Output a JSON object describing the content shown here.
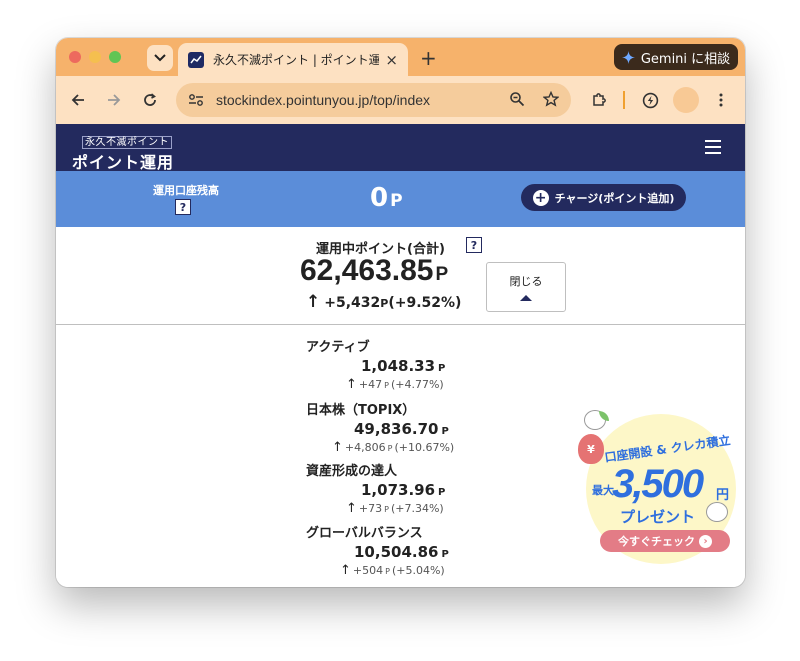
{
  "browser": {
    "tab_title": "永久不滅ポイント | ポイント運用",
    "url": "stockindex.pointunyou.jp/top/index",
    "gemini_label": "Gemini に相談",
    "new_tab": "+",
    "tab_close": "×"
  },
  "site": {
    "logo_small": "永久不滅ポイント",
    "logo_big": "ポイント運用"
  },
  "balance": {
    "label": "運用口座残高",
    "help": "?",
    "value": "0",
    "unit": "P",
    "charge_button": "チャージ(ポイント追加)",
    "charge_icon": "+"
  },
  "summary": {
    "label": "運用中ポイント(合計)",
    "help": "?",
    "total": "62,463.85",
    "unit": "P",
    "change_arrow": "↑",
    "change": "+5,432",
    "change_unit": "P",
    "change_pct": "(+9.52%)",
    "close_button": "閉じる"
  },
  "funds": [
    {
      "name": "アクティブ",
      "value": "1,048.33",
      "unit": "P",
      "arrow": "↑",
      "change": "+47",
      "change_unit": "P",
      "pct": "(+4.77%)"
    },
    {
      "name": "日本株（TOPIX）",
      "value": "49,836.70",
      "unit": "P",
      "arrow": "↑",
      "change": "+4,806",
      "change_unit": "P",
      "pct": "(+10.67%)"
    },
    {
      "name": "資産形成の達人",
      "value": "1,073.96",
      "unit": "P",
      "arrow": "↑",
      "change": "+73",
      "change_unit": "P",
      "pct": "(+7.34%)"
    },
    {
      "name": "グローバルバランス",
      "value": "10,504.86",
      "unit": "P",
      "arrow": "↑",
      "change": "+504",
      "change_unit": "P",
      "pct": "(+5.04%)"
    }
  ],
  "promo": {
    "top_text": "口座開設 & クレカ積立",
    "max_text": "最大",
    "amount": "3,500",
    "yen": "円",
    "present": "プレゼント",
    "button": "今すぐチェック",
    "bag_symbol": "¥"
  },
  "colors": {
    "tab_strip": "#f6b26b",
    "toolbar": "#fde1c2",
    "site_header": "#232a5e",
    "balance_bar": "#5b8dd9",
    "promo_blue": "#2f6fde",
    "promo_button": "#e37c86"
  }
}
